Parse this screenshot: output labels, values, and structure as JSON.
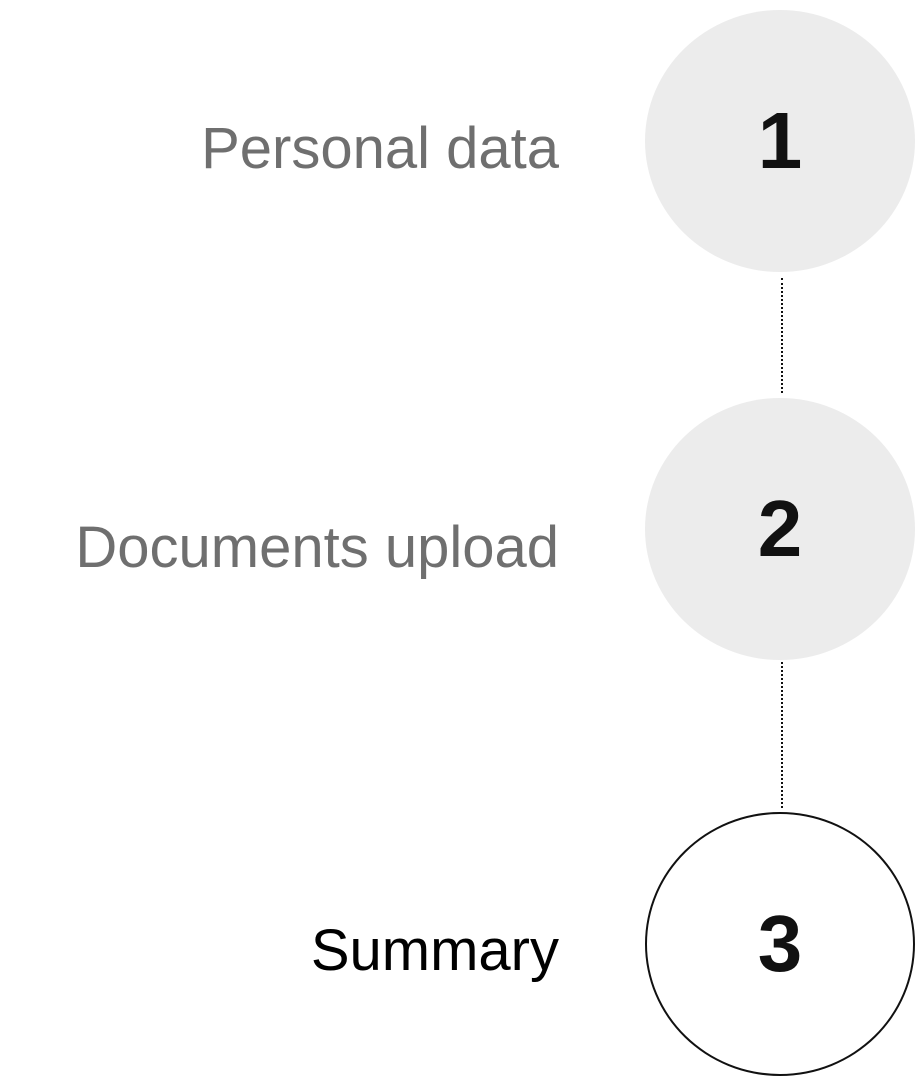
{
  "stepper": {
    "steps": [
      {
        "number": "1",
        "label": "Personal data",
        "state": "inactive"
      },
      {
        "number": "2",
        "label": "Documents upload",
        "state": "inactive"
      },
      {
        "number": "3",
        "label": "Summary",
        "state": "active"
      }
    ]
  },
  "colors": {
    "inactive_label": "#6f6f6f",
    "active_label": "#000000",
    "inactive_circle_fill": "#ececec",
    "active_circle_border": "#111111",
    "number": "#111111",
    "connector": "#111111"
  }
}
